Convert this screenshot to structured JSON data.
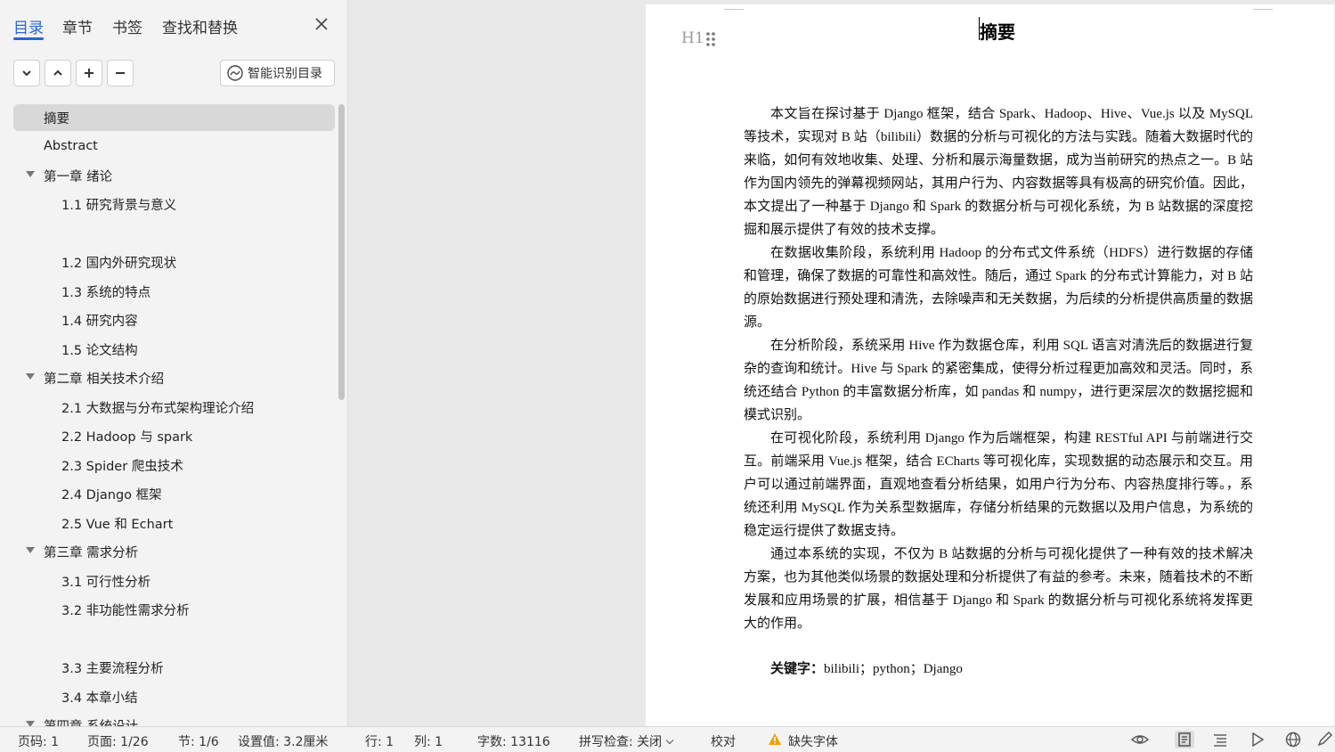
{
  "nav": {
    "tabs": [
      "目录",
      "章节",
      "书签",
      "查找和替换"
    ],
    "smart_toc_label": "智能识别目录",
    "toc": [
      {
        "label": "摘要",
        "level": 1,
        "selected": true
      },
      {
        "label": "Abstract",
        "level": 1
      },
      {
        "label": "第一章  绪论",
        "level": 1,
        "expanded": true
      },
      {
        "label": "1.1 研究背景与意义",
        "level": 2
      },
      {
        "label": "1.2 国内外研究现状",
        "level": 2
      },
      {
        "label": "1.3 系统的特点",
        "level": 2
      },
      {
        "label": "1.4 研究内容",
        "level": 2
      },
      {
        "label": "1.5 论文结构",
        "level": 2
      },
      {
        "label": "第二章  相关技术介绍",
        "level": 1,
        "expanded": true
      },
      {
        "label": "2.1  大数据与分布式架构理论介绍",
        "level": 2
      },
      {
        "label": "2.2 Hadoop 与 spark",
        "level": 2
      },
      {
        "label": "2.3 Spider 爬虫技术",
        "level": 2
      },
      {
        "label": "2.4 Django 框架",
        "level": 2
      },
      {
        "label": "2.5 Vue 和 Echart",
        "level": 2
      },
      {
        "label": "第三章  需求分析",
        "level": 1,
        "expanded": true
      },
      {
        "label": "3.1 可行性分析",
        "level": 2
      },
      {
        "label": "3.2  非功能性需求分析",
        "level": 2
      },
      {
        "label": "3.3 主要流程分析",
        "level": 2
      },
      {
        "label": "3.4 本章小结",
        "level": 2
      },
      {
        "label": "第四章  系统设计",
        "level": 1,
        "expanded": true
      }
    ]
  },
  "document": {
    "heading_marker": "H1",
    "title": "摘要",
    "paragraphs": [
      "本文旨在探讨基于 Django 框架，结合 Spark、Hadoop、Hive、Vue.js 以及 MySQL 等技术，实现对 B 站（bilibili）数据的分析与可视化的方法与实践。随着大数据时代的来临，如何有效地收集、处理、分析和展示海量数据，成为当前研究的热点之一。B 站作为国内领先的弹幕视频网站，其用户行为、内容数据等具有极高的研究价值。因此，本文提出了一种基于 Django 和 Spark 的数据分析与可视化系统，为 B 站数据的深度挖掘和展示提供了有效的技术支撑。",
      "在数据收集阶段，系统利用 Hadoop 的分布式文件系统（HDFS）进行数据的存储和管理，确保了数据的可靠性和高效性。随后，通过 Spark 的分布式计算能力，对 B 站的原始数据进行预处理和清洗，去除噪声和无关数据，为后续的分析提供高质量的数据源。",
      "在分析阶段，系统采用 Hive 作为数据仓库，利用 SQL 语言对清洗后的数据进行复杂的查询和统计。Hive 与 Spark 的紧密集成，使得分析过程更加高效和灵活。同时，系统还结合 Python 的丰富数据分析库，如 pandas 和 numpy，进行更深层次的数据挖掘和模式识别。",
      "在可视化阶段，系统利用 Django 作为后端框架，构建 RESTful API 与前端进行交互。前端采用 Vue.js 框架，结合 ECharts 等可视化库，实现数据的动态展示和交互。用户可以通过前端界面，直观地查看分析结果，如用户行为分布、内容热度排行等。，系统还利用 MySQL 作为关系型数据库，存储分析结果的元数据以及用户信息，为系统的稳定运行提供了数据支持。",
      "通过本系统的实现，不仅为 B 站数据的分析与可视化提供了一种有效的技术解决方案，也为其他类似场景的数据处理和分析提供了有益的参考。未来，随着技术的不断发展和应用场景的扩展，相信基于 Django 和 Spark 的数据分析与可视化系统将发挥更大的作用。"
    ],
    "keywords_label": "关键字：",
    "keywords_value": "bilibili；python；Django"
  },
  "status": {
    "page_no": "页码: 1",
    "pages": "页面: 1/26",
    "section": "节: 1/6",
    "setting": "设置值: 3.2厘米",
    "row": "行: 1",
    "col": "列: 1",
    "word_count": "字数: 13116",
    "spellcheck": "拼写检查: 关闭",
    "proofread": "校对",
    "missing_font": "缺失字体"
  },
  "colors": {
    "accent": "#2a64d4",
    "warning": "#f0a000"
  }
}
